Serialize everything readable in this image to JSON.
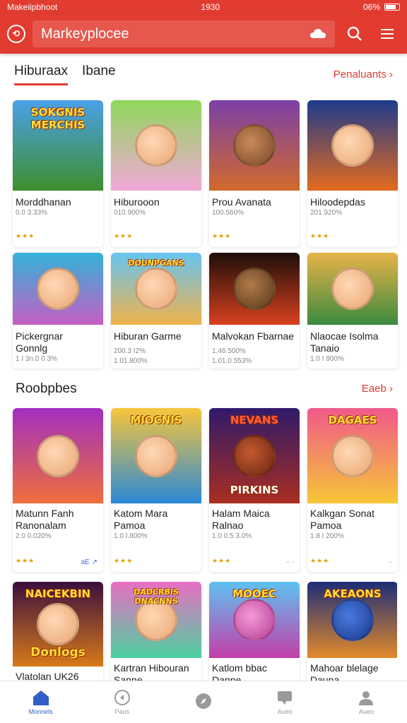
{
  "status": {
    "carrier": "Makeiipbhoot",
    "time": "1930",
    "battery": "06%"
  },
  "appbar": {
    "search_text": "Markeyplocee"
  },
  "tabs": [
    {
      "label": "Hiburaax",
      "active": true
    },
    {
      "label": "Ibane",
      "active": false
    }
  ],
  "section1": {
    "link": "Penaluants ›"
  },
  "section2": {
    "title": "Roobpbes",
    "link": "Eaeb ›"
  },
  "row1": [
    {
      "name": "Morddhanan",
      "meta": "0.0 3.33%",
      "stars": "★★★",
      "banner": "SOKGNIS MERCHIS",
      "bg": [
        "#4aa0e8",
        "#3e8f2d"
      ]
    },
    {
      "name": "Hiburooon",
      "meta": "010.900%",
      "stars": "★★★",
      "banner": "",
      "bg": [
        "#8fd85a",
        "#f2a8d8"
      ]
    },
    {
      "name": "Prou Avanata",
      "meta": "100.560%",
      "stars": "★★★",
      "banner": "",
      "bg": [
        "#7b3fa8",
        "#d16a2b"
      ]
    },
    {
      "name": "Hiloodepdas",
      "meta": "201.920%",
      "stars": "★★★",
      "banner": "",
      "bg": [
        "#1d3a8c",
        "#e46a1e"
      ]
    }
  ],
  "row2": [
    {
      "name": "Pickergnar",
      "name2": "Gonnlg",
      "meta": "1 I 3n.0 0 3%",
      "banner": "",
      "bg": [
        "#32b3d8",
        "#c65ec4"
      ]
    },
    {
      "name": "Hiburan Garme",
      "name2": "",
      "meta": "200.3 I2%",
      "meta2": "1.01.800%",
      "banner": "DOUNPGANS",
      "bg": [
        "#66c4f0",
        "#f0b24a"
      ]
    },
    {
      "name": "Malvokan Fbarnae",
      "name2": "",
      "meta": "1.46.500%",
      "meta2": "1.01.0 553%",
      "banner": "",
      "bg": [
        "#1e0e0a",
        "#d9401f"
      ]
    },
    {
      "name": "Nlaocae Isolma",
      "name2": "Tanaio",
      "meta": "1.0 I 800%",
      "banner": "",
      "bg": [
        "#e7b348",
        "#3c8a3f"
      ]
    }
  ],
  "row3": [
    {
      "name": "Matunn Fanh",
      "name2": "Ranonalam",
      "meta": "2.0 0.020%",
      "stars": "★★★",
      "extra": "aE ↗",
      "banner": "",
      "bg": [
        "#a12fbf",
        "#ef6f3c"
      ]
    },
    {
      "name": "Katom Mara",
      "name2": "Pamoa",
      "meta": "1.0 I.800%",
      "stars": "★★★",
      "extra": "",
      "banner": "MIOCNIS",
      "bg": [
        "#f7c63b",
        "#2a88d6"
      ]
    },
    {
      "name": "Halam Maica",
      "name2": "Ralnao",
      "meta": "1.0 0.5 3.0%",
      "stars": "★★★",
      "extra": "∙∙ ∙",
      "banner": "NEVANS",
      "banner2": "PIRKINS",
      "bg": [
        "#2f1a6b",
        "#a92e20"
      ]
    },
    {
      "name": "Kalkgan Sonat",
      "name2": "Pamoa",
      "meta": "1.8 I 200%",
      "stars": "★★★",
      "extra": "∙∙",
      "banner": "DAGAES",
      "bg": [
        "#f0598a",
        "#f7c637"
      ]
    }
  ],
  "row4": [
    {
      "name": "Vlatolan UK26",
      "name2": "",
      "banner": "NAICEKBIN",
      "banner2": "Donlogs",
      "bg": [
        "#3a0f3e",
        "#d87a1a"
      ]
    },
    {
      "name": "Kartran Hibouran",
      "name2": "Sanne",
      "banner": "DADCRBIS DNACNNS",
      "bg": [
        "#e86fc2",
        "#4dd0a0"
      ]
    },
    {
      "name": "Katlom bbac",
      "name2": "Danne",
      "banner": "MOOEC",
      "bg": [
        "#5ec2f2",
        "#c43ea8"
      ]
    },
    {
      "name": "Mahoar blelage",
      "name2": "Dauna",
      "banner": "AKEAONS",
      "bg": [
        "#1b2d78",
        "#e38a2b"
      ]
    }
  ],
  "nav": [
    {
      "label": "Monnels",
      "icon": "home-icon",
      "active": true
    },
    {
      "label": "Paus",
      "icon": "rewind-icon",
      "active": false
    },
    {
      "label": "",
      "icon": "compass-icon",
      "active": false
    },
    {
      "label": "Aueo",
      "icon": "chat-icon",
      "active": false
    },
    {
      "label": "Aueo",
      "icon": "profile-icon",
      "active": false
    }
  ],
  "colors": {
    "brand": "#e23b2f",
    "nav_active": "#2f5fc7",
    "star": "#e5a000"
  }
}
